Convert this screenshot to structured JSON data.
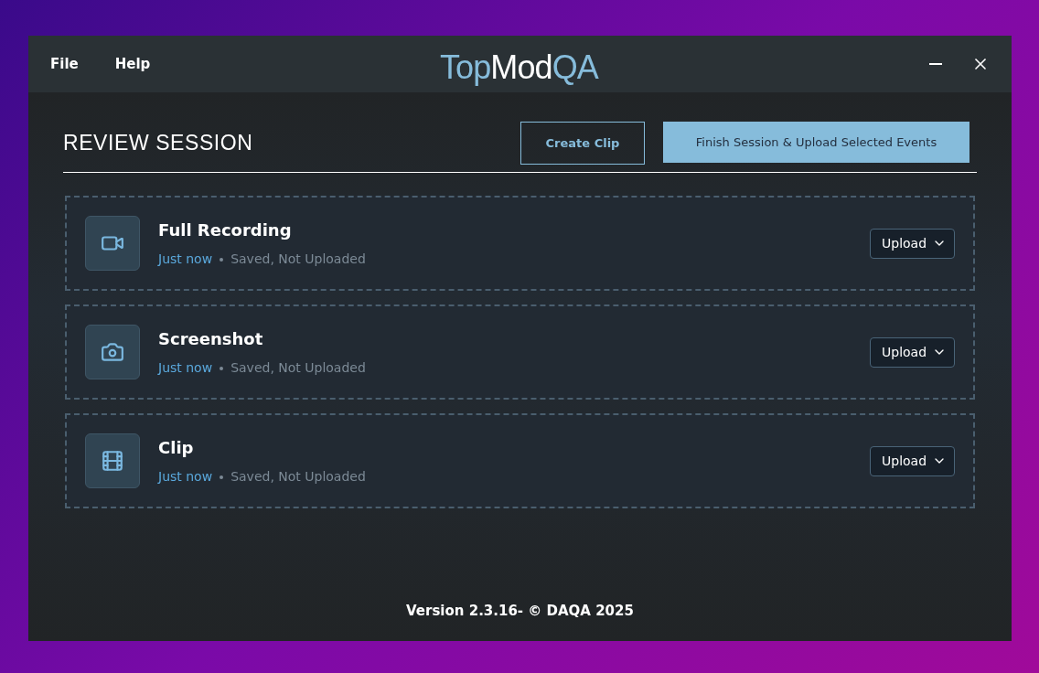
{
  "menu": [
    "File",
    "Help"
  ],
  "logo": [
    {
      "text": "Top",
      "color": "#86bcdb"
    },
    {
      "text": "Mod",
      "color": "#ffffff"
    },
    {
      "text": "QA",
      "color": "#86bcdb"
    }
  ],
  "heading": "REVIEW SESSION",
  "buttons": {
    "create": "Create Clip",
    "finish": "Finish Session & Upload Selected Events"
  },
  "events": [
    {
      "kind": "video",
      "title": "Full Recording",
      "time": "Just now",
      "status": "Saved, Not Uploaded",
      "action": "Upload"
    },
    {
      "kind": "camera",
      "title": "Screenshot",
      "time": "Just now",
      "status": "Saved, Not Uploaded",
      "action": "Upload"
    },
    {
      "kind": "film",
      "title": "Clip",
      "time": "Just now",
      "status": "Saved, Not Uploaded",
      "action": "Upload"
    }
  ],
  "footer": "Version 2.3.16- © DAQA 2025"
}
